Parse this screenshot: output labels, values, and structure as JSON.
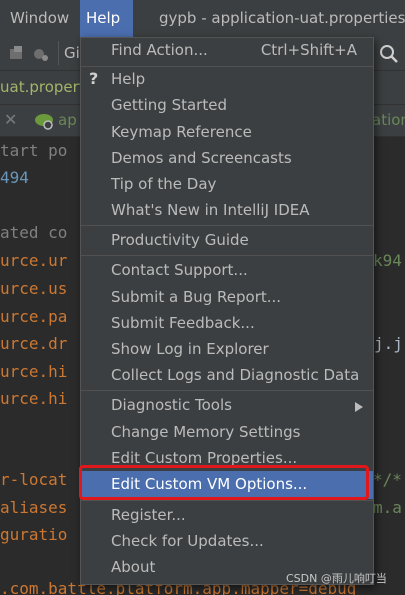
{
  "menubar": {
    "window": "Window",
    "help": "Help",
    "title": "gypb - application-uat.properties"
  },
  "toolbar": {
    "git_label": "Gi"
  },
  "nav": {
    "file": "uat.properti"
  },
  "tabs": {
    "tab1": "ap",
    "tab_right": "ation"
  },
  "editor": {
    "lines": [
      "tart po",
      "494",
      "",
      "ated co",
      "urce.ur",
      "urce.us",
      "urce.pa",
      "urce.dr",
      "urce.hi",
      "urce.hi",
      "",
      "",
      "r-locat",
      "aliases",
      "guratio",
      "",
      ".com.battle.platform.app.mapper=debug"
    ],
    "right_1": "k94",
    "right_2": "j.j",
    "right_3": "*/*",
    "right_4": "m.a"
  },
  "help_menu": {
    "items": [
      {
        "label": "Find Action...",
        "shortcut": "Ctrl+Shift+A"
      },
      {
        "label": "Help",
        "icon": "question-icon"
      },
      {
        "label": "Getting Started"
      },
      {
        "label": "Keymap Reference"
      },
      {
        "label": "Demos and Screencasts"
      },
      {
        "label": "Tip of the Day"
      },
      {
        "label": "What's New in IntelliJ IDEA"
      },
      {
        "label": "Productivity Guide"
      },
      {
        "label": "Contact Support..."
      },
      {
        "label": "Submit a Bug Report..."
      },
      {
        "label": "Submit Feedback..."
      },
      {
        "label": "Show Log in Explorer"
      },
      {
        "label": "Collect Logs and Diagnostic Data"
      },
      {
        "label": "Diagnostic Tools",
        "submenu": true
      },
      {
        "label": "Change Memory Settings"
      },
      {
        "label": "Edit Custom Properties..."
      },
      {
        "label": "Edit Custom VM Options...",
        "highlighted": true
      },
      {
        "label": "Register..."
      },
      {
        "label": "Check for Updates..."
      },
      {
        "label": "About"
      }
    ]
  },
  "watermark": "CSDN @雨儿响叮当",
  "colors": {
    "menu_bg": "#3c3f41",
    "highlight": "#4b6eaf",
    "annotation_red": "#e0171b"
  }
}
